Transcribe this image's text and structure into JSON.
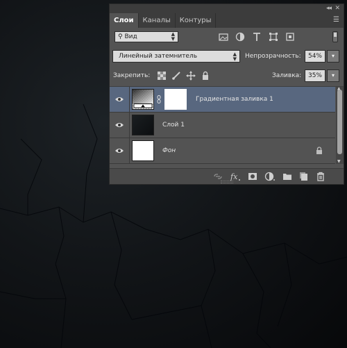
{
  "tabs": [
    "Слои",
    "Каналы",
    "Контуры"
  ],
  "filter": {
    "selected": "Вид"
  },
  "blend_mode": "Линейный затемнитель",
  "opacity": {
    "label": "Непрозрачность:",
    "value": "54%"
  },
  "lock": {
    "label": "Закрепить:"
  },
  "fill": {
    "label": "Заливка:",
    "value": "35%"
  },
  "layers": [
    {
      "name": "Градиентная заливка 1",
      "selected": true
    },
    {
      "name": "Слой 1",
      "selected": false
    },
    {
      "name": "Фон",
      "selected": false,
      "locked": true
    }
  ],
  "colors": {
    "panel": "#535353",
    "selected_row": "#58677f",
    "canvas": "#111417"
  },
  "icons": {
    "filter_types": [
      "image-filter-icon",
      "adjustment-filter-icon",
      "type-filter-icon",
      "shape-filter-icon",
      "smart-object-filter-icon"
    ],
    "locks": [
      "lock-transparent-pixels-icon",
      "lock-image-pixels-icon",
      "lock-position-icon",
      "lock-all-icon"
    ],
    "footer": [
      "link-layers-icon",
      "fx-icon",
      "add-mask-icon",
      "new-adjustment-layer-icon",
      "new-group-icon",
      "new-layer-icon",
      "delete-layer-icon"
    ]
  }
}
